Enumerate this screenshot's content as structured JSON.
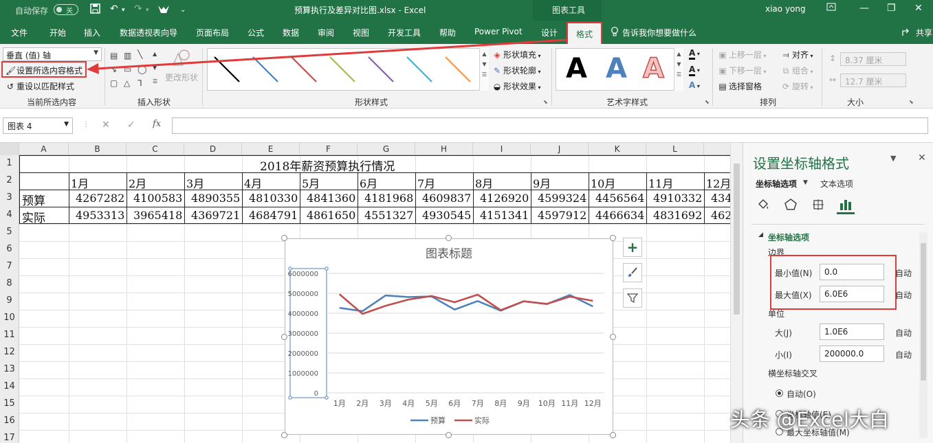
{
  "titlebar": {
    "autosave_label": "自动保存",
    "autosave_state": "关",
    "doc_title": "预算执行及差异对比图.xlsx  -  Excel",
    "chart_tools": "图表工具",
    "user": "xiao yong"
  },
  "tabs": {
    "file": "文件",
    "home": "开始",
    "insert": "插入",
    "pivot": "数据透视表向导",
    "layout": "页面布局",
    "formula": "公式",
    "data": "数据",
    "review": "审阅",
    "view": "视图",
    "developer": "开发工具",
    "help": "帮助",
    "powerpivot": "Power Pivot",
    "design": "设计",
    "format": "格式",
    "tellme": "告诉我你想要做什么",
    "share": "共享"
  },
  "ribbon": {
    "selection_combo": "垂直 (值) 轴",
    "format_selection": "设置所选内容格式",
    "reset_style": "重设以匹配样式",
    "group_current": "当前所选内容",
    "change_shape": "更改形状",
    "group_insert_shapes": "插入形状",
    "group_shape_styles": "形状样式",
    "shape_fill": "形状填充",
    "shape_outline": "形状轮廓",
    "shape_effects": "形状效果",
    "group_wordart": "艺术字样式",
    "wordart_letter": "A",
    "bring_forward": "上移一层",
    "send_backward": "下移一层",
    "selection_pane": "选择窗格",
    "align": "对齐",
    "group": "组合",
    "rotate": "旋转",
    "group_arrange": "排列",
    "height": "8.37 厘米",
    "width": "12.7 厘米",
    "group_size": "大小",
    "line_colors": [
      "#000000",
      "#4a7ebb",
      "#c0504d",
      "#9bbb59",
      "#8064a2",
      "#4bacc6",
      "#f79646"
    ]
  },
  "formulabar": {
    "namebox": "图表 4",
    "fx": "fx",
    "cancel": "✕",
    "enter": "✓"
  },
  "sheet": {
    "columns": [
      "A",
      "B",
      "C",
      "D",
      "E",
      "F",
      "G",
      "H",
      "I",
      "J",
      "K",
      "L"
    ],
    "rows": [
      "1",
      "2",
      "3",
      "4",
      "5",
      "6",
      "7",
      "8",
      "9",
      "10",
      "11",
      "12",
      "13",
      "14",
      "15",
      "16",
      "17"
    ],
    "title": "2018年薪资预算执行情况",
    "months": [
      "1月",
      "2月",
      "3月",
      "4月",
      "5月",
      "6月",
      "7月",
      "8月",
      "9月",
      "10月",
      "11月",
      "12月"
    ],
    "budget_label": "预算",
    "actual_label": "实际",
    "budget_cells": [
      "4267282",
      "4100583",
      "4890355",
      "4810330",
      "4841360",
      "4181968",
      "4609837",
      "4126920",
      "4599324",
      "4456564",
      "4910332",
      "434"
    ],
    "actual_cells": [
      "4953313",
      "3965418",
      "4369721",
      "4684791",
      "4861650",
      "4551327",
      "4930545",
      "4151341",
      "4597912",
      "4466634",
      "4831692",
      "462"
    ]
  },
  "chart_data": {
    "type": "line",
    "title": "图表标题",
    "categories": [
      "1月",
      "2月",
      "3月",
      "4月",
      "5月",
      "6月",
      "7月",
      "8月",
      "9月",
      "10月",
      "11月",
      "12月"
    ],
    "series": [
      {
        "name": "预算",
        "color": "#4f81bd",
        "values": [
          4267282,
          4100583,
          4890355,
          4810330,
          4841360,
          4181968,
          4609837,
          4126920,
          4599324,
          4456564,
          4910332,
          4340000
        ]
      },
      {
        "name": "实际",
        "color": "#c0504d",
        "values": [
          4953313,
          3965418,
          4369721,
          4684791,
          4861650,
          4551327,
          4930545,
          4151341,
          4597912,
          4466634,
          4831692,
          4620000
        ]
      }
    ],
    "yticks": [
      "0",
      "1000000",
      "2000000",
      "3000000",
      "4000000",
      "5000000",
      "6000000"
    ],
    "ylim": [
      0,
      6000000
    ],
    "grid": true,
    "legend": "bottom"
  },
  "side_buttons": {
    "add": "+",
    "brush": "brush",
    "filter": "filter"
  },
  "pane": {
    "title": "设置坐标轴格式",
    "tab_axis_options": "坐标轴选项",
    "tab_text_options": "文本选项",
    "section": "坐标轴选项",
    "bounds": "边界",
    "min_label": "最小值(N)",
    "min_value": "0.0",
    "max_label": "最大值(X)",
    "max_value": "6.0E6",
    "auto": "自动",
    "units": "单位",
    "major_label": "大(J)",
    "major_value": "1.0E6",
    "minor_label": "小(I)",
    "minor_value": "200000.0",
    "cross": "横坐标轴交叉",
    "radio_auto": "自动(O)",
    "radio_value": "坐标轴值(E)",
    "radio_max": "最大坐标轴值(M)"
  },
  "watermark": "头条 @Excel大白"
}
